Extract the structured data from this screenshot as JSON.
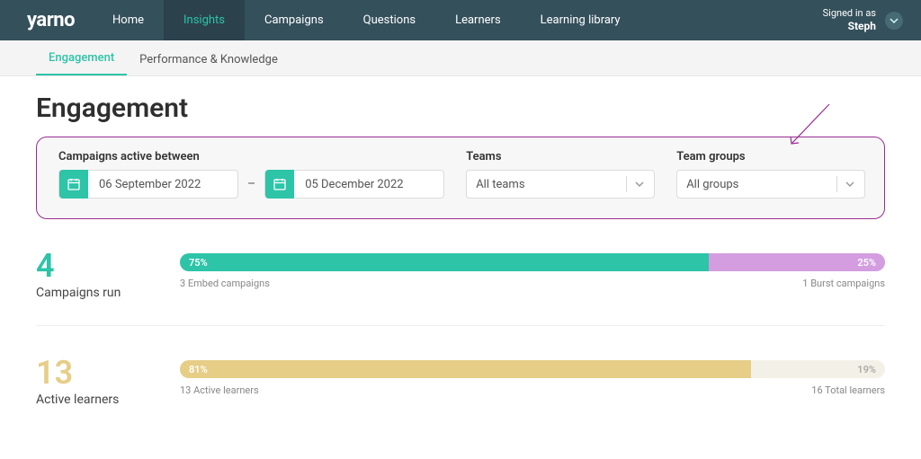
{
  "nav": {
    "brand": "yarno",
    "items": [
      "Home",
      "Insights",
      "Campaigns",
      "Questions",
      "Learners",
      "Learning library"
    ],
    "active_index": 1,
    "signed_in_label": "Signed in as",
    "user": "Steph"
  },
  "subnav": {
    "tabs": [
      "Engagement",
      "Performance & Knowledge"
    ],
    "active_index": 0
  },
  "page": {
    "title": "Engagement"
  },
  "filters": {
    "date_label": "Campaigns active between",
    "date_from": "06 September 2022",
    "date_to": "05 December 2022",
    "teams_label": "Teams",
    "teams_value": "All teams",
    "groups_label": "Team groups",
    "groups_value": "All groups"
  },
  "stats": {
    "campaigns": {
      "value": "4",
      "label": "Campaigns run",
      "left_pct": "75%",
      "right_pct": "25%",
      "left_caption": "3 Embed campaigns",
      "right_caption": "1 Burst campaigns"
    },
    "learners": {
      "value": "13",
      "label": "Active learners",
      "left_pct": "81%",
      "right_pct": "19%",
      "left_caption": "13 Active learners",
      "right_caption": "16 Total learners"
    }
  }
}
